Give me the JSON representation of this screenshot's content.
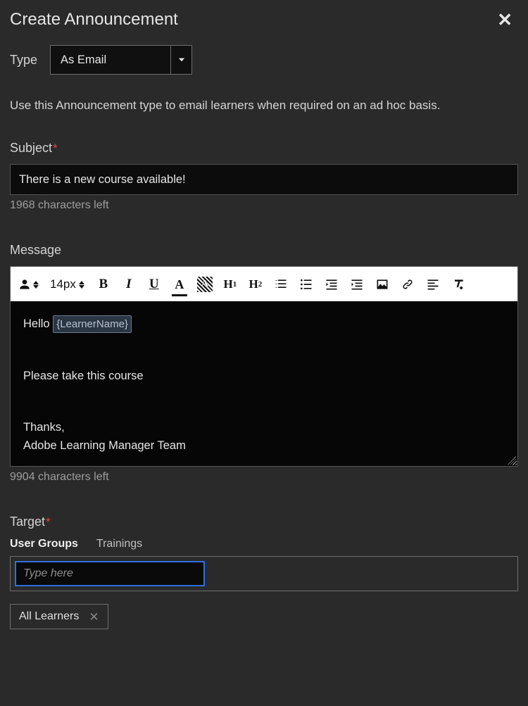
{
  "title": "Create Announcement",
  "type": {
    "label": "Type",
    "selected": "As Email",
    "description": "Use this Announcement type to email learners when required on an ad hoc basis."
  },
  "subject": {
    "label": "Subject",
    "value": "There is a new course available!",
    "counter": "1968 characters left"
  },
  "message": {
    "label": "Message",
    "font_size": "14px",
    "greeting_prefix": "Hello ",
    "placeholder_token": "{LearnerName}",
    "body_line": "Please take this course",
    "thanks": "Thanks,",
    "signature": "Adobe Learning Manager Team",
    "counter": "9904 characters left"
  },
  "target": {
    "label": "Target",
    "tabs": {
      "user_groups": "User Groups",
      "trainings": "Trainings"
    },
    "input_placeholder": "Type here",
    "chip": "All Learners"
  },
  "icons": {
    "close": "✕",
    "remove_chip": "✕"
  }
}
